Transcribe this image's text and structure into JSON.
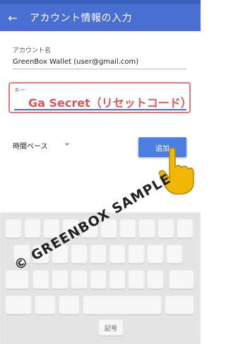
{
  "appbar": {
    "title": "アカウント情報の入力"
  },
  "account": {
    "label": "アカウント名",
    "value": "GreenBox Wallet (user@gmail.com)"
  },
  "key": {
    "label": "キー",
    "value": "Ga Secret（リセットコード）"
  },
  "time": {
    "label": "時間ベース"
  },
  "add_button": {
    "label": "追加"
  },
  "keyboard": {
    "key_hint": "記号"
  },
  "watermark": {
    "text": "© GREENBOX SAMPLE"
  },
  "colors": {
    "appbar": "#4a6fd3",
    "highlight": "#e05555",
    "button": "#4a7fe0"
  },
  "icons": [
    "back-arrow-icon",
    "chevron-down-icon",
    "pointing-hand-icon"
  ]
}
